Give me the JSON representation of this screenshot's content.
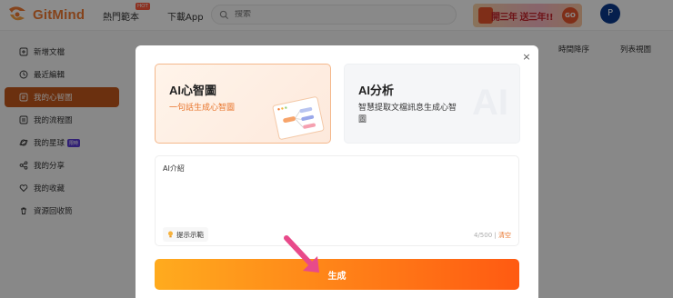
{
  "app": {
    "name": "GitMind"
  },
  "topnav": {
    "hot_templates": "熱門範本",
    "hot_badge": "HOT",
    "download": "下載App"
  },
  "search": {
    "placeholder": "搜索"
  },
  "promo": {
    "text": "開三年 送三年!!",
    "go": "GO"
  },
  "user": {
    "avatar_letter": "P"
  },
  "sidebar": {
    "items": [
      {
        "label": "新增文檔",
        "icon": "add-doc-icon"
      },
      {
        "label": "最近編輯",
        "icon": "clock-icon"
      },
      {
        "label": "我的心智圖",
        "icon": "mindmap-icon"
      },
      {
        "label": "我的流程圖",
        "icon": "flowchart-icon"
      },
      {
        "label": "我的星球",
        "icon": "planet-icon",
        "badge": "限時"
      },
      {
        "label": "我的分享",
        "icon": "share-icon"
      },
      {
        "label": "我的收藏",
        "icon": "heart-icon"
      },
      {
        "label": "資源回收筒",
        "icon": "trash-icon"
      }
    ]
  },
  "main": {
    "sort_label": "時間降序",
    "view_label": "列表視圖"
  },
  "modal": {
    "close": "×",
    "cards": [
      {
        "title": "AI心智圖",
        "subtitle": "一句話生成心智圖"
      },
      {
        "title": "AI分析",
        "subtitle": "智慧提取文檔訊息生成心智圖",
        "watermark": "AI"
      }
    ],
    "input": {
      "value": "AI介紹"
    },
    "hint": "提示示範",
    "counter": "4/500",
    "clear": "清空",
    "generate": "生成"
  },
  "colors": {
    "brand": "#f27a32",
    "active": "#c3581c",
    "button_start": "#ffab1e",
    "button_end": "#ff5a12",
    "arrow": "#e84a8a"
  }
}
